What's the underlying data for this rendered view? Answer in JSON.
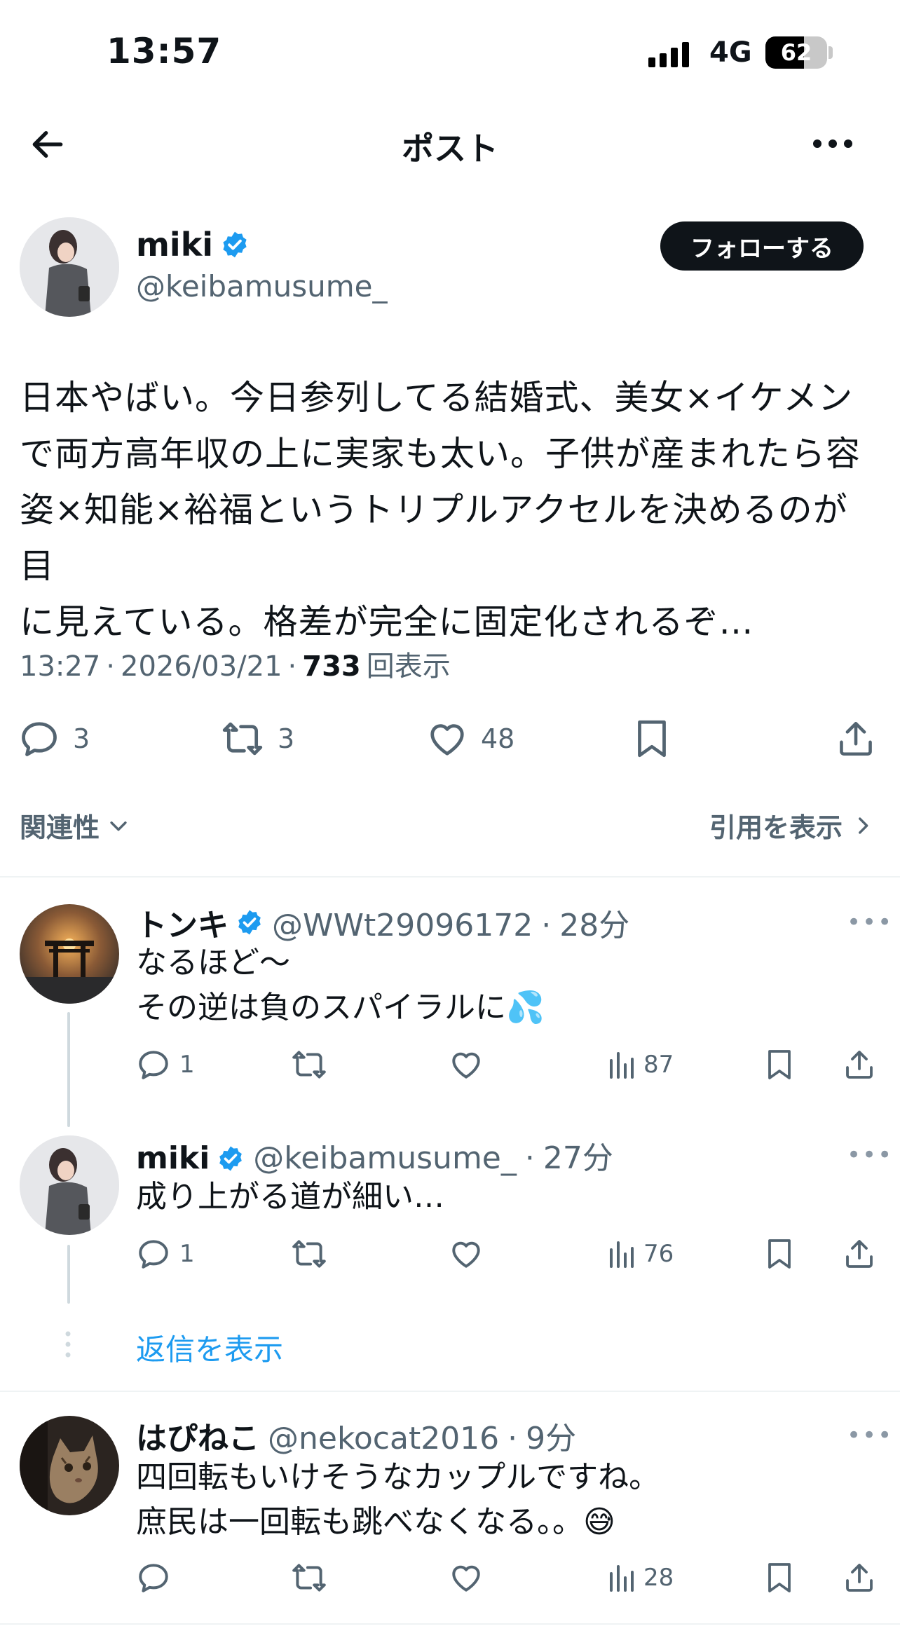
{
  "status_bar": {
    "time": "13:57",
    "network": "4G",
    "battery": "62"
  },
  "header": {
    "title": "ポスト"
  },
  "post": {
    "author_name": "miki",
    "author_handle": "@keibamusume_",
    "follow_label": "フォローする",
    "text_lines": [
      "日本やばい。今日参列してる結婚式、美女×イケメン",
      "で両方高年収の上に実家も太い。子供が産まれたら容",
      "姿×知能×裕福というトリプルアクセルを決めるのが目",
      "に見えている。格差が完全に固定化されるぞ…"
    ],
    "time": "13:27",
    "date": "2026/03/21",
    "views": "733",
    "views_label": "回表示",
    "replies": "3",
    "reposts": "3",
    "likes": "48"
  },
  "filter": {
    "related_label": "関連性",
    "quotes_label": "引用を表示"
  },
  "replies": [
    {
      "name": "トンキ",
      "handle": "@WWt29096172",
      "time": "28分",
      "lines": [
        "なるほど〜",
        "その逆は負のスパイラルに"
      ],
      "emoji": "💦",
      "reply_count": "1",
      "views": "87"
    },
    {
      "name": "miki",
      "handle": "@keibamusume_",
      "time": "27分",
      "lines": [
        "成り上がる道が細い…"
      ],
      "reply_count": "1",
      "views": "76"
    },
    {
      "name": "はぴねこ",
      "handle": "@nekocat2016",
      "time": "9分",
      "lines": [
        "四回転もいけそうなカップルですね。",
        "庶民は一回転も跳べなくなる。。"
      ],
      "emoji": "😅",
      "reply_count": "",
      "views": "28"
    }
  ],
  "show_replies_label": "返信を表示",
  "colors": {
    "verified": "#1d9bf0",
    "link": "#1d9bf0",
    "text": "#0f1419",
    "secondary": "#536471"
  }
}
